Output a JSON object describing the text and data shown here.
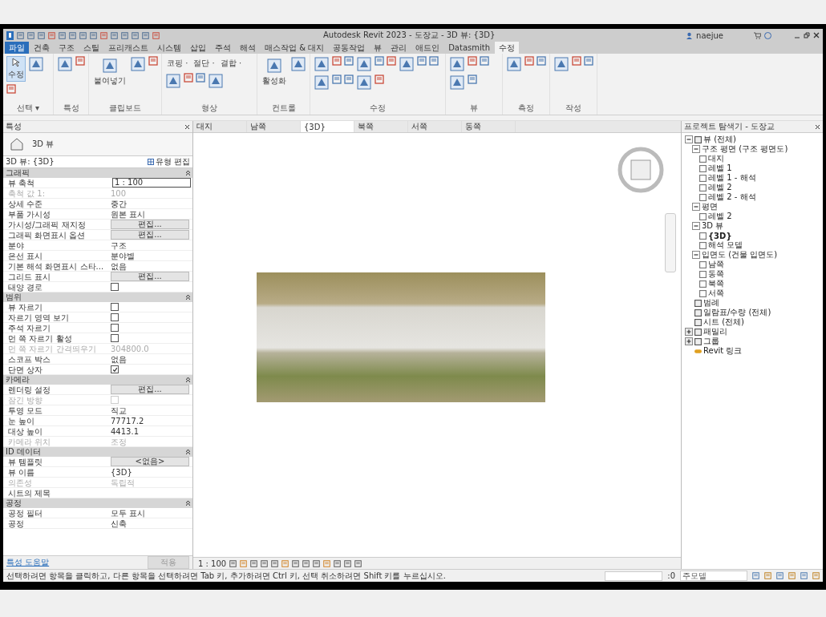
{
  "window": {
    "title": "Autodesk Revit 2023 - 도장교 - 3D 뷰: {3D}",
    "user": "naejue"
  },
  "ribbon_tabs": [
    {
      "label": "파일",
      "selected": false,
      "kind": "file"
    },
    {
      "label": "건축",
      "selected": false,
      "kind": "tab"
    },
    {
      "label": "구조",
      "selected": false,
      "kind": "tab"
    },
    {
      "label": "스틸",
      "selected": false,
      "kind": "tab"
    },
    {
      "label": "프리캐스트",
      "selected": false,
      "kind": "tab"
    },
    {
      "label": "시스템",
      "selected": false,
      "kind": "tab"
    },
    {
      "label": "삽입",
      "selected": false,
      "kind": "tab"
    },
    {
      "label": "주석",
      "selected": false,
      "kind": "tab"
    },
    {
      "label": "해석",
      "selected": false,
      "kind": "tab"
    },
    {
      "label": "매스작업 & 대지",
      "selected": false,
      "kind": "tab"
    },
    {
      "label": "공동작업",
      "selected": false,
      "kind": "tab"
    },
    {
      "label": "뷰",
      "selected": false,
      "kind": "tab"
    },
    {
      "label": "관리",
      "selected": false,
      "kind": "tab"
    },
    {
      "label": "애드인",
      "selected": false,
      "kind": "tab"
    },
    {
      "label": "Datasmith",
      "selected": false,
      "kind": "tab"
    },
    {
      "label": "수정",
      "selected": true,
      "kind": "tab"
    }
  ],
  "ribbon_panels": [
    {
      "label": "선택 ▾",
      "tools": [
        "수정"
      ]
    },
    {
      "label": "특성"
    },
    {
      "label": "클립보드",
      "tools": [
        "붙여넣기"
      ]
    },
    {
      "label": "형상",
      "tools": [
        "코핑 ·",
        "절단 ·",
        "결합 ·"
      ]
    },
    {
      "label": "컨트롤",
      "tools": [
        "활성화"
      ]
    },
    {
      "label": "수정"
    },
    {
      "label": "뷰"
    },
    {
      "label": "측정"
    },
    {
      "label": "작성"
    }
  ],
  "properties": {
    "title": "특성",
    "type_name": "3D 뷰",
    "view_selector": "3D 뷰: {3D}",
    "edit_type": "유형 편집",
    "help_link": "특성 도움말",
    "apply": "적용",
    "sections": [
      {
        "name": "그래픽",
        "rows": [
          {
            "label": "뷰 축척",
            "value": "1 : 100",
            "kind": "input",
            "disabled": false
          },
          {
            "label": "축척 값    1:",
            "value": "100",
            "kind": "text",
            "disabled": true
          },
          {
            "label": "상세 수준",
            "value": "중간",
            "kind": "text",
            "disabled": false
          },
          {
            "label": "부품 가시성",
            "value": "원본 표시",
            "kind": "text",
            "disabled": false
          },
          {
            "label": "가시성/그래픽 재지정",
            "value": "편집...",
            "kind": "button",
            "disabled": false
          },
          {
            "label": "그래픽 화면표시 옵션",
            "value": "편집...",
            "kind": "button",
            "disabled": false
          },
          {
            "label": "분야",
            "value": "구조",
            "kind": "text",
            "disabled": false
          },
          {
            "label": "은선 표시",
            "value": "분야별",
            "kind": "text",
            "disabled": false
          },
          {
            "label": "기본 해석 화면표시 스타...",
            "value": "없음",
            "kind": "text",
            "disabled": false
          },
          {
            "label": "그리드 표시",
            "value": "편집...",
            "kind": "button",
            "disabled": false
          },
          {
            "label": "태양 경로",
            "kind": "checkbox",
            "checked": false,
            "disabled": false
          }
        ]
      },
      {
        "name": "범위",
        "rows": [
          {
            "label": "뷰 자르기",
            "kind": "checkbox",
            "checked": false,
            "disabled": false
          },
          {
            "label": "자르기 영역 보기",
            "kind": "checkbox",
            "checked": false,
            "disabled": false
          },
          {
            "label": "주석 자르기",
            "kind": "checkbox",
            "checked": false,
            "disabled": false
          },
          {
            "label": "먼 쪽 자르기 활성",
            "kind": "checkbox",
            "checked": false,
            "disabled": false
          },
          {
            "label": "먼 쪽 자르기 간격띄우기",
            "value": "304800.0",
            "kind": "text",
            "disabled": true
          },
          {
            "label": "스코프 박스",
            "value": "없음",
            "kind": "text",
            "disabled": false
          },
          {
            "label": "단면 상자",
            "kind": "checkbox",
            "checked": true,
            "disabled": false
          }
        ]
      },
      {
        "name": "카메라",
        "rows": [
          {
            "label": "렌더링 설정",
            "value": "편집...",
            "kind": "button",
            "disabled": false
          },
          {
            "label": "잠긴 방향",
            "kind": "checkbox",
            "checked": false,
            "disabled": true
          },
          {
            "label": "투영 모드",
            "value": "직교",
            "kind": "text",
            "disabled": false
          },
          {
            "label": "눈 높이",
            "value": "77717.2",
            "kind": "text",
            "disabled": false
          },
          {
            "label": "대상 높이",
            "value": "4413.1",
            "kind": "text",
            "disabled": false
          },
          {
            "label": "카메라 위치",
            "value": "조정",
            "kind": "text",
            "disabled": true
          }
        ]
      },
      {
        "name": "ID 데이터",
        "rows": [
          {
            "label": "뷰 템플릿",
            "value": "<없음>",
            "kind": "button",
            "disabled": false
          },
          {
            "label": "뷰 이름",
            "value": "{3D}",
            "kind": "text",
            "disabled": false
          },
          {
            "label": "의존성",
            "value": "독립적",
            "kind": "text",
            "disabled": true
          },
          {
            "label": "시트의 제목",
            "kind": "text",
            "disabled": false
          }
        ]
      },
      {
        "name": "공정",
        "rows": [
          {
            "label": "공정 필터",
            "value": "모두 표시",
            "kind": "text",
            "disabled": false
          },
          {
            "label": "공정",
            "value": "신축",
            "kind": "text",
            "disabled": false
          }
        ]
      }
    ]
  },
  "view_tabs": [
    {
      "label": "대지",
      "selected": false
    },
    {
      "label": "남쪽",
      "selected": false
    },
    {
      "label": "{3D}",
      "selected": true
    },
    {
      "label": "북쪽",
      "selected": false
    },
    {
      "label": "서쪽",
      "selected": false
    },
    {
      "label": "동쪽",
      "selected": false
    }
  ],
  "view_control": {
    "scale": "1 : 100"
  },
  "project_browser": {
    "title": "프로젝트 탐색기 - 도장교",
    "tree": [
      {
        "label": "뷰 (전체)",
        "kind": "views",
        "expanded": true,
        "children": [
          {
            "label": "구조 평면 (구조 평면도)",
            "kind": "group",
            "expanded": true,
            "children": [
              {
                "label": "대지",
                "kind": "view",
                "selected": false
              },
              {
                "label": "레벨 1",
                "kind": "view",
                "selected": false
              },
              {
                "label": "레벨 1 - 해석",
                "kind": "view",
                "selected": false
              },
              {
                "label": "레벨 2",
                "kind": "view",
                "selected": false
              },
              {
                "label": "레벨 2 - 해석",
                "kind": "view",
                "selected": false
              }
            ]
          },
          {
            "label": "평면",
            "kind": "group",
            "expanded": true,
            "children": [
              {
                "label": "레벨 2",
                "kind": "view",
                "selected": false
              }
            ]
          },
          {
            "label": "3D 뷰",
            "kind": "group",
            "expanded": true,
            "children": [
              {
                "label": "{3D}",
                "kind": "view",
                "selected": true
              },
              {
                "label": "해석 모델",
                "kind": "view",
                "selected": false
              }
            ]
          },
          {
            "label": "입면도 (건물 입면도)",
            "kind": "group",
            "expanded": true,
            "children": [
              {
                "label": "남쪽",
                "kind": "view",
                "selected": false
              },
              {
                "label": "동쪽",
                "kind": "view",
                "selected": false
              },
              {
                "label": "북쪽",
                "kind": "view",
                "selected": false
              },
              {
                "label": "서쪽",
                "kind": "view",
                "selected": false
              }
            ]
          }
        ]
      },
      {
        "label": "범례",
        "kind": "legend"
      },
      {
        "label": "일람표/수량 (전체)",
        "kind": "schedule"
      },
      {
        "label": "시트 (전체)",
        "kind": "sheet"
      },
      {
        "label": "패밀리",
        "kind": "family",
        "expanded": false
      },
      {
        "label": "그룹",
        "kind": "group-node",
        "expanded": false
      },
      {
        "label": "Revit 링크",
        "kind": "link"
      }
    ]
  },
  "status_bar": {
    "message": "선택하려면 항목을 클릭하고, 다른 항목을 선택하려면 Tab 키, 추가하려면 Ctrl 키, 선택 취소하려면 Shift 키를 누르십시오.",
    "selection_count": ":0",
    "model": "주모델"
  }
}
